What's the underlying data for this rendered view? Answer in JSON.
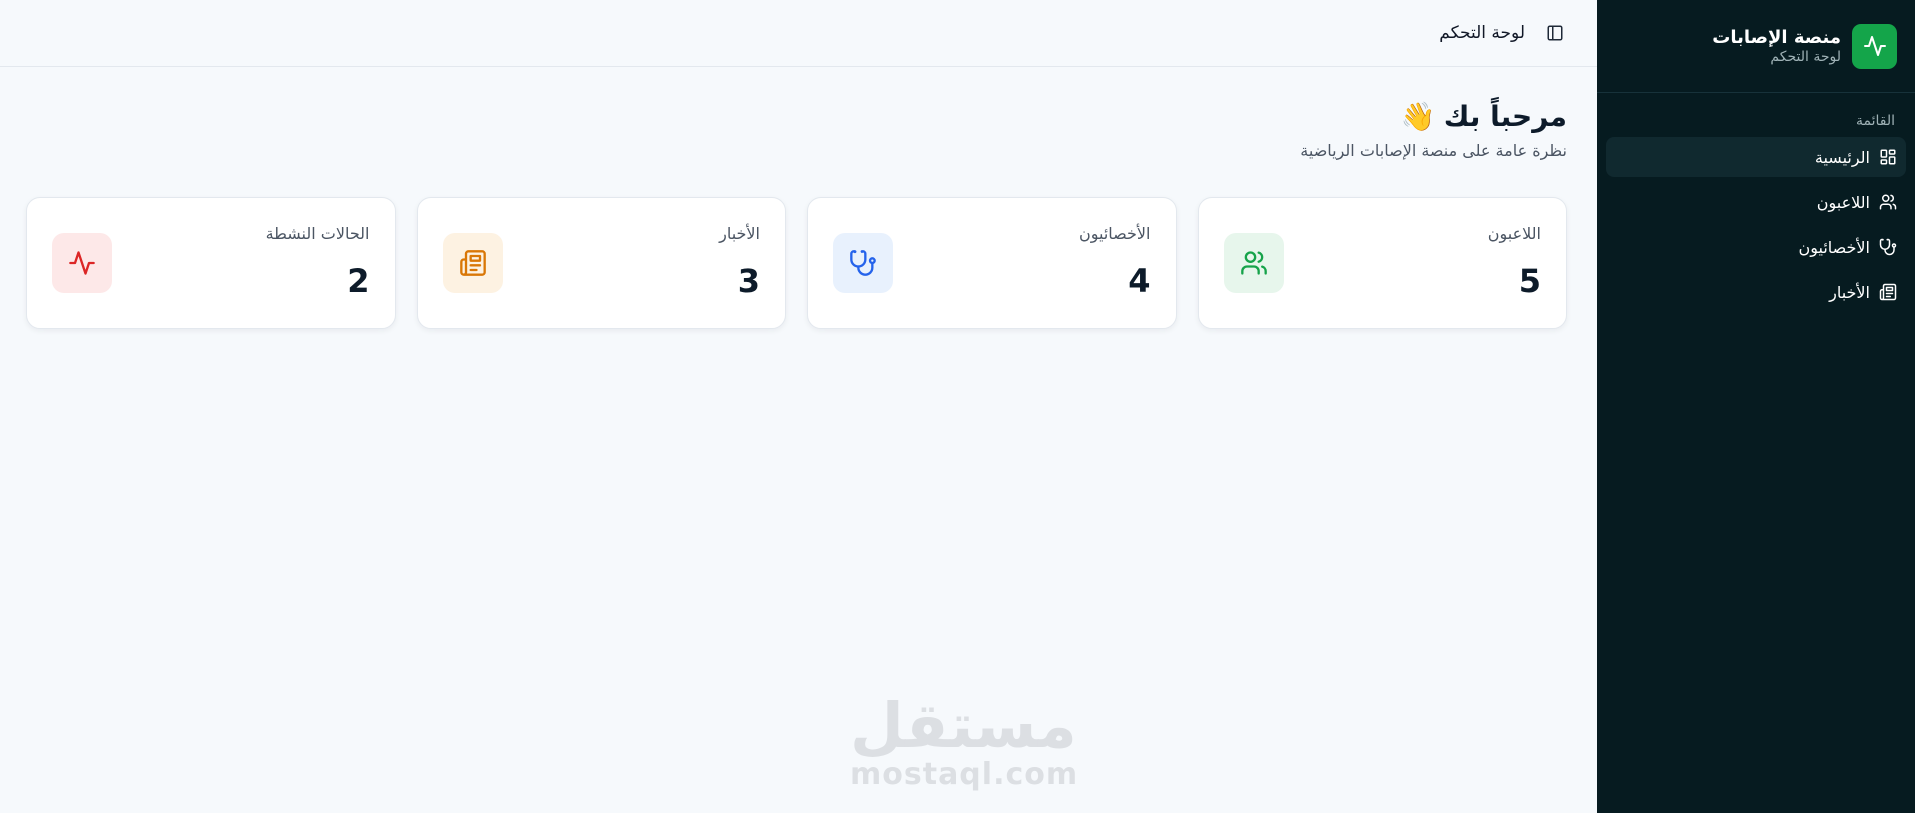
{
  "sidebar": {
    "brand": {
      "title": "منصة الإصابات",
      "subtitle": "لوحة التحكم",
      "logo_icon": "activity-icon",
      "logo_color": "#14a54a"
    },
    "section_heading": "القائمة",
    "items": [
      {
        "label": "الرئيسية",
        "icon": "dashboard-grid-icon",
        "active": true
      },
      {
        "label": "اللاعبون",
        "icon": "users-icon",
        "active": false
      },
      {
        "label": "الأخصائيون",
        "icon": "stethoscope-icon",
        "active": false
      },
      {
        "label": "الأخبار",
        "icon": "newspaper-icon",
        "active": false
      }
    ]
  },
  "topbar": {
    "title": "لوحة التحكم",
    "toggle_icon": "sidebar-toggle-icon"
  },
  "welcome": {
    "title": "مرحباً بك",
    "emoji": "👋",
    "subtitle": "نظرة عامة على منصة الإصابات الرياضية"
  },
  "stats": [
    {
      "label": "اللاعبون",
      "value": "5",
      "icon": "users-icon",
      "color": "#16a34a",
      "bg": "#e7f6ec"
    },
    {
      "label": "الأخصائيون",
      "value": "4",
      "icon": "stethoscope-icon",
      "color": "#2563eb",
      "bg": "#e8f1fd"
    },
    {
      "label": "الأخبار",
      "value": "3",
      "icon": "newspaper-icon",
      "color": "#d97706",
      "bg": "#fdf2e2"
    },
    {
      "label": "الحالات النشطة",
      "value": "2",
      "icon": "activity-icon",
      "color": "#dc2626",
      "bg": "#fde8e8"
    }
  ],
  "watermark": {
    "arabic": "مستقل",
    "latin": "mostaql.com"
  }
}
